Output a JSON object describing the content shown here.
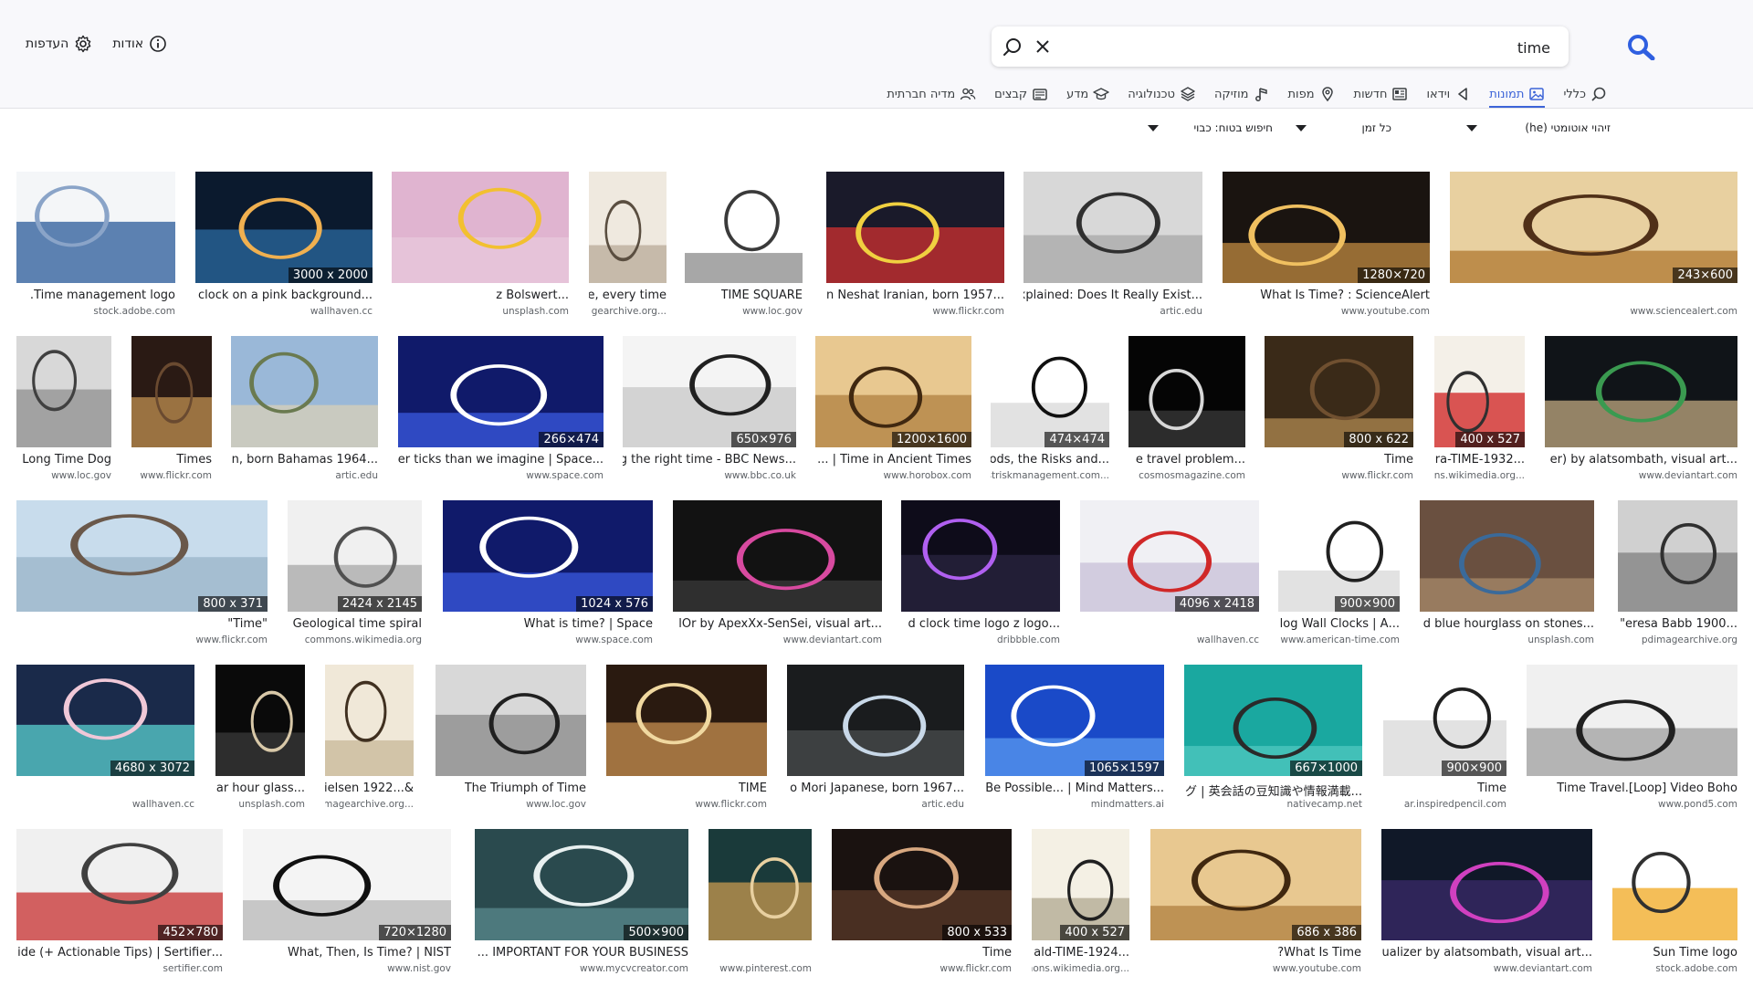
{
  "search": {
    "value": "time"
  },
  "top_links": {
    "about": "אודות",
    "preferences": "העדפות"
  },
  "tabs": [
    {
      "label": "כללי",
      "icon": "search-icon"
    },
    {
      "label": "תמונות",
      "icon": "image-icon",
      "active": true
    },
    {
      "label": "וידאו",
      "icon": "play-icon"
    },
    {
      "label": "חדשות",
      "icon": "newspaper-icon"
    },
    {
      "label": "מפות",
      "icon": "map-pin-icon"
    },
    {
      "label": "מוזיקה",
      "icon": "music-icon"
    },
    {
      "label": "טכנולוגיה",
      "icon": "layers-icon"
    },
    {
      "label": "מדע",
      "icon": "graduation-icon"
    },
    {
      "label": "קבצים",
      "icon": "file-icon"
    },
    {
      "label": "מדיה חברתית",
      "icon": "people-icon"
    }
  ],
  "filters": {
    "language": "זיהוי אוטומטי (he)",
    "time": "כל זמן",
    "safesearch": "חיפוש בטוח: כבוי"
  },
  "colors": {
    "accent": "#3c64d8",
    "logo": "#2f5fe0"
  },
  "rows": [
    [
      {
        "caption": "Time management logo.",
        "source": "stock.adobe.com",
        "dims": "",
        "palette": [
          "#f4f6f8",
          "#2a5a9a",
          "#8aa4c8"
        ]
      },
      {
        "caption": "...clock on a pink background",
        "source": "wallhaven.cc",
        "dims": "3000 x 2000",
        "palette": [
          "#0b1a2e",
          "#2b6aa0",
          "#f0b050"
        ]
      },
      {
        "caption": "...z Bolswert",
        "source": "unsplash.com",
        "dims": "",
        "palette": [
          "#e0b4d0",
          "#e8c8dc",
          "#f2c030"
        ]
      },
      {
        "caption": "time, every time ...",
        "source": "...gearchive.org",
        "dims": "",
        "palette": [
          "#efe9df",
          "#b8aa98",
          "#5a4e40"
        ]
      },
      {
        "caption": "TIME SQUARE",
        "source": "www.loc.gov",
        "dims": "",
        "palette": [
          "#ffffff",
          "#8a8a8a",
          "#3a3a3a"
        ]
      },
      {
        "caption": "...n Neshat Iranian, born 1957",
        "source": "www.flickr.com",
        "dims": "",
        "palette": [
          "#1a1a2a",
          "#d03030",
          "#f0d040"
        ]
      },
      {
        "caption": "...e Explained: Does It Really Exist",
        "source": "artic.edu",
        "dims": "",
        "palette": [
          "#d8d8d8",
          "#a8a8a8",
          "#303030"
        ]
      },
      {
        "caption": "What Is Time? : ScienceAlert",
        "source": "www.youtube.com",
        "dims": "1280×720",
        "palette": [
          "#1a1410",
          "#c08a40",
          "#f0c060"
        ]
      },
      {
        "caption": "",
        "source": "www.sciencealert.com",
        "dims": "243×600",
        "palette": [
          "#e8d0a0",
          "#b07830",
          "#503018"
        ]
      }
    ],
    [
      {
        "caption": "Long Time Dog",
        "source": "www.loc.gov",
        "dims": "",
        "palette": [
          "#d8d8d8",
          "#909090",
          "#404040"
        ]
      },
      {
        "caption": "Times",
        "source": "www.flickr.com",
        "dims": "",
        "palette": [
          "#2a1a14",
          "#c09050",
          "#6a4a30"
        ]
      },
      {
        "caption": "...n, born Bahamas 1964",
        "source": "artic.edu",
        "dims": "",
        "palette": [
          "#9ab8d8",
          "#d8d0b8",
          "#6a7a50"
        ]
      },
      {
        "caption": "...er ticks than we imagine | Space",
        "source": "www.space.com",
        "dims": "266×474",
        "palette": [
          "#101a6a",
          "#3a5ae0",
          "#ffffff"
        ]
      },
      {
        "caption": "...g the right time - BBC News",
        "source": "www.bbc.co.uk",
        "dims": "650×976",
        "palette": [
          "#f4f4f4",
          "#c8c8c8",
          "#202020"
        ]
      },
      {
        "caption": "Time in Ancient Times | ...",
        "source": "www.horobox.com",
        "dims": "1200×1600",
        "palette": [
          "#e8c890",
          "#b08040",
          "#402810"
        ]
      },
      {
        "caption": "...ods, the Risks and",
        "source": "...striskmanagement.com",
        "dims": "474×474",
        "palette": [
          "#ffffff",
          "#d8d8d8",
          "#101010"
        ]
      },
      {
        "caption": "...e travel problem",
        "source": "cosmosmagazine.com",
        "dims": "",
        "palette": [
          "#050505",
          "#3a3a3a",
          "#d8d8d8"
        ]
      },
      {
        "caption": "Time",
        "source": "www.flickr.com",
        "dims": "800 x 622",
        "palette": [
          "#3a2a18",
          "#b08a50",
          "#705030"
        ]
      },
      {
        "caption": "...ra-TIME-1932",
        "source": "...ons.wikimedia.org",
        "dims": "400 x 527",
        "palette": [
          "#f4f0e8",
          "#d02020",
          "#303030"
        ]
      },
      {
        "caption": "...er) by alatsombath, visual art",
        "source": "www.deviantart.com",
        "dims": "",
        "palette": [
          "#101418",
          "#c0a880",
          "#3a9a50"
        ]
      }
    ],
    [
      {
        "caption": "\"Time\"",
        "source": "www.flickr.com",
        "dims": "800 x 371",
        "palette": [
          "#c8dcec",
          "#9ab4c8",
          "#6a584a"
        ]
      },
      {
        "caption": "Geological time spiral",
        "source": "commons.wikimedia.org",
        "dims": "2424 x 2145",
        "palette": [
          "#f0f0f0",
          "#a8a8a8",
          "#505050"
        ]
      },
      {
        "caption": "What is time? | Space",
        "source": "www.space.com",
        "dims": "1024 x 576",
        "palette": [
          "#101a6a",
          "#3a5ae0",
          "#ffffff"
        ]
      },
      {
        "caption": "...lOr by ApexXx-SenSei, visual art",
        "source": "www.deviantart.com",
        "dims": "",
        "palette": [
          "#121212",
          "#3a3a3a",
          "#d84aa0"
        ]
      },
      {
        "caption": "...d clock time logo z logo",
        "source": "dribbble.com",
        "dims": "",
        "palette": [
          "#0e0c1a",
          "#2a2440",
          "#b060f0"
        ]
      },
      {
        "caption": "",
        "source": "wallhaven.cc",
        "dims": "4096 x 2418",
        "palette": [
          "#f0f0f4",
          "#c8c0d8",
          "#d02828"
        ]
      },
      {
        "caption": "...log Wall Clocks | A",
        "source": "www.american-time.com",
        "dims": "900×900",
        "palette": [
          "#ffffff",
          "#d8d8d8",
          "#202020"
        ]
      },
      {
        "caption": "...d blue hourglass on stones",
        "source": "unsplash.com",
        "dims": "",
        "palette": [
          "#6a5040",
          "#a88a6a",
          "#3a6a9a"
        ]
      },
      {
        "caption": "...eresa Babb 1900\"",
        "source": "pdimagearchive.org",
        "dims": "",
        "palette": [
          "#d0d0d0",
          "#808080",
          "#303030"
        ]
      }
    ],
    [
      {
        "caption": "",
        "source": "wallhaven.cc",
        "dims": "4680 x 3072",
        "palette": [
          "#1a2a4a",
          "#5ad0d0",
          "#f0c8d8"
        ]
      },
      {
        "caption": "...ar hour glass",
        "source": "unsplash.com",
        "dims": "",
        "palette": [
          "#0a0a0a",
          "#3a3a3a",
          "#d8c8a8"
        ]
      },
      {
        "caption": "&...ielsen 1922",
        "source": "...imagearchive.org",
        "dims": "",
        "palette": [
          "#f0e8d8",
          "#c8b898",
          "#403020"
        ]
      },
      {
        "caption": "The Triumph of Time",
        "source": "www.loc.gov",
        "dims": "",
        "palette": [
          "#d8d8d8",
          "#8a8a8a",
          "#202020"
        ]
      },
      {
        "caption": "TIME",
        "source": "www.flickr.com",
        "dims": "",
        "palette": [
          "#2a1a10",
          "#c89050",
          "#f0d8a0"
        ]
      },
      {
        "caption": "...o Mori Japanese, born 1967",
        "source": "artic.edu",
        "dims": "",
        "palette": [
          "#1a1c1e",
          "#4a4c4e",
          "#c8d8e8"
        ]
      },
      {
        "caption": "...Be Possible... | Mind Matters",
        "source": "mindmatters.ai",
        "dims": "1065×1597",
        "palette": [
          "#1a4ac8",
          "#5a9af0",
          "#ffffff"
        ]
      },
      {
        "caption": "...グ | 英会話の豆知識や情報満載",
        "source": "nativecamp.net",
        "dims": "667×1000",
        "palette": [
          "#1aa8a0",
          "#50c8c0",
          "#2a2a2a"
        ]
      },
      {
        "caption": "Time",
        "source": "ar.inspiredpencil.com",
        "dims": "900×900",
        "palette": [
          "#ffffff",
          "#d8d8d8",
          "#202020"
        ]
      },
      {
        "caption": "Time Travel.[Loop] Video Boho",
        "source": "www.pond5.com",
        "dims": "",
        "palette": [
          "#f0f0f0",
          "#a0a0a0",
          "#202020"
        ]
      }
    ],
    [
      {
        "caption": "...ide (+ Actionable Tips) | Sertifier",
        "source": "sertifier.com",
        "dims": "452×780",
        "palette": [
          "#f0f0f0",
          "#c83030",
          "#404040"
        ]
      },
      {
        "caption": "What, Then, Is Time? | NIST",
        "source": "www.nist.gov",
        "dims": "720×1280",
        "palette": [
          "#f4f4f4",
          "#b8b8b8",
          "#101010"
        ]
      },
      {
        "caption": "IMPORTANT FOR YOUR BUSINESS ...",
        "source": "www.mycvcreator.com",
        "dims": "500×900",
        "palette": [
          "#2a4a4e",
          "#5a8a8e",
          "#e8f0f0"
        ]
      },
      {
        "caption": "",
        "source": "www.pinterest.com",
        "dims": "",
        "palette": [
          "#1a3a3a",
          "#c89a50",
          "#e8d0a0"
        ]
      },
      {
        "caption": "Time",
        "source": "www.flickr.com",
        "dims": "800 x 533",
        "palette": [
          "#1a1210",
          "#5a3a28",
          "#d8a880"
        ]
      },
      {
        "caption": "...ald-TIME-1924",
        "source": "...mons.wikimedia.org",
        "dims": "400 x 527",
        "palette": [
          "#f4f0e4",
          "#b0a890",
          "#202020"
        ]
      },
      {
        "caption": "What Is Time?",
        "source": "www.youtube.com",
        "dims": "686 x 386",
        "palette": [
          "#e8c890",
          "#b08040",
          "#402810"
        ]
      },
      {
        "caption": "...ualizer by alatsombath, visual art",
        "source": "www.deviantart.com",
        "dims": "",
        "palette": [
          "#101828",
          "#3a2a6a",
          "#d040c0"
        ]
      },
      {
        "caption": "Sun Time logo",
        "source": "stock.adobe.com",
        "dims": "",
        "palette": [
          "#ffffff",
          "#f0a820",
          "#303030"
        ]
      }
    ]
  ]
}
